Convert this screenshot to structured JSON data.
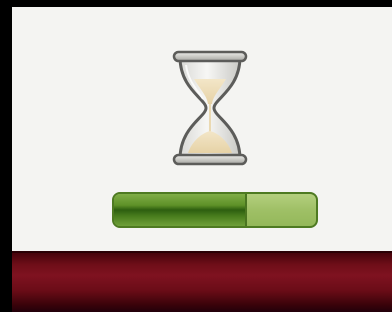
{
  "app": {
    "state": "loading",
    "colors": {
      "panel_background": "#f4f4f2",
      "progress_fill": "#3e7418",
      "progress_track": "#a8c872",
      "footer_bar": "#6e0e18"
    }
  },
  "loading_indicator": {
    "icon": "hourglass-icon",
    "progress_percent": 66
  }
}
